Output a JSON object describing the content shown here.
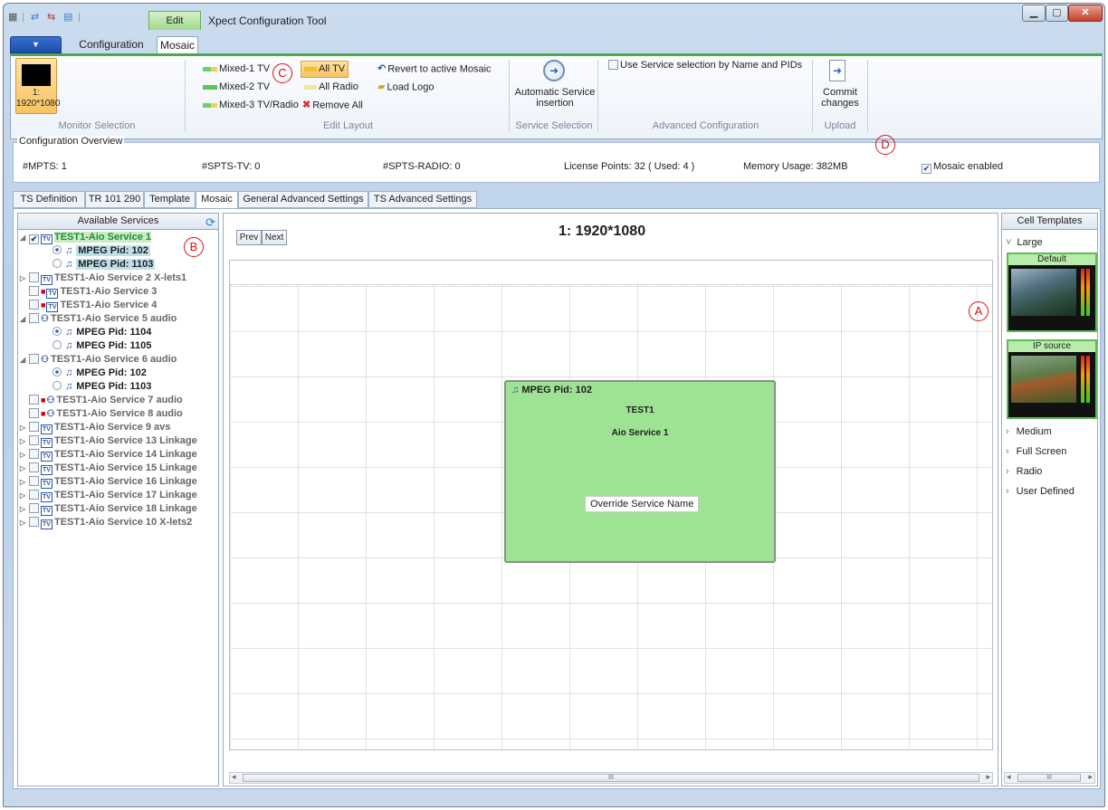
{
  "window": {
    "edit_tab": "Edit",
    "title": "Xpect Configuration Tool"
  },
  "ribbon": {
    "tabs": [
      "Configuration",
      "Mosaic"
    ],
    "monitor": {
      "label": "1:\n1920*1080",
      "group": "Monitor Selection"
    },
    "edit_layout": {
      "group": "Edit Layout",
      "mixed1": "Mixed-1 TV",
      "mixed2": "Mixed-2 TV",
      "mixed3": "Mixed-3 TV/Radio",
      "all_tv": "All TV",
      "all_radio": "All Radio",
      "remove_all": "Remove All",
      "revert": "Revert to active Mosaic",
      "load_logo": "Load Logo"
    },
    "service_selection": {
      "group": "Service Selection",
      "button": "Automatic Service insertion"
    },
    "advanced": {
      "group": "Advanced Configuration",
      "checkbox": "Use Service selection by Name and PIDs"
    },
    "upload": {
      "group": "Upload",
      "button": "Commit changes"
    }
  },
  "overview": {
    "legend": "Configuration Overview",
    "mpts": "#MPTS:  1",
    "spts_tv": "#SPTS-TV:  0",
    "spts_radio": "#SPTS-RADIO:  0",
    "license": "License Points: 32 ( Used: 4 )",
    "memory": "Memory Usage:  382MB",
    "mosaic_enabled": "Mosaic enabled"
  },
  "content_tabs": [
    "TS Definition",
    "TR 101 290",
    "Template",
    "Mosaic",
    "General Advanced Settings",
    "TS Advanced Settings"
  ],
  "available_services": {
    "header": "Available Services",
    "items": [
      {
        "text": "TEST1-Aio Service 1"
      },
      {
        "text": "MPEG Pid: 102"
      },
      {
        "text": "MPEG Pid: 1103"
      },
      {
        "text": "TEST1-Aio Service 2 X-lets1"
      },
      {
        "text": "TEST1-Aio Service 3"
      },
      {
        "text": "TEST1-Aio Service 4"
      },
      {
        "text": "TEST1-Aio Service 5 audio"
      },
      {
        "text": "MPEG Pid: 1104"
      },
      {
        "text": "MPEG Pid: 1105"
      },
      {
        "text": "TEST1-Aio Service 6 audio"
      },
      {
        "text": "MPEG Pid: 102"
      },
      {
        "text": "MPEG Pid: 1103"
      },
      {
        "text": "TEST1-Aio Service 7 audio"
      },
      {
        "text": "TEST1-Aio Service 8 audio"
      },
      {
        "text": "TEST1-Aio Service 9 avs"
      },
      {
        "text": "TEST1-Aio Service 13 Linkage"
      },
      {
        "text": "TEST1-Aio Service 14 Linkage"
      },
      {
        "text": "TEST1-Aio Service 15 Linkage"
      },
      {
        "text": "TEST1-Aio Service 16 Linkage"
      },
      {
        "text": "TEST1-Aio Service 17 Linkage"
      },
      {
        "text": "TEST1-Aio Service 18 Linkage"
      },
      {
        "text": "TEST1-Aio Service 10 X-lets2"
      }
    ]
  },
  "mosaic": {
    "prev": "Prev",
    "next": "Next",
    "title": "1: 1920*1080",
    "cell": {
      "pid": "MPEG Pid: 102",
      "line1": "TEST1",
      "line2": "Aio Service 1",
      "override": "Override Service Name"
    }
  },
  "cell_templates": {
    "header": "Cell Templates",
    "large": "Large",
    "default": "Default",
    "ip_source": "IP source",
    "medium": "Medium",
    "full_screen": "Full Screen",
    "radio": "Radio",
    "user_defined": "User Defined"
  },
  "annotations": {
    "a": "A",
    "b": "B",
    "c": "C",
    "d": "D"
  },
  "scroll_mark": "III"
}
